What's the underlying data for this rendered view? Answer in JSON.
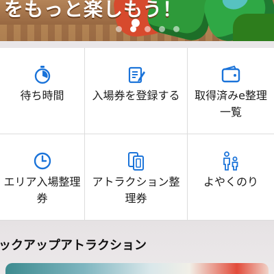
{
  "banner": {
    "headline": "をもっと楽しもう！",
    "slide_count": 5,
    "active_slide_index": 1
  },
  "menu": {
    "items": [
      {
        "label": "待ち時間",
        "icon": "stopwatch-icon"
      },
      {
        "label": "入場券を登録する",
        "icon": "ticket-edit-icon"
      },
      {
        "label": "取得済みe整理\n一覧",
        "icon": "wallet-icon"
      },
      {
        "label": "エリア入場整理\n券",
        "icon": "clock-icon"
      },
      {
        "label": "アトラクション整\n理券",
        "icon": "tickets-icon"
      },
      {
        "label": "よやくのり",
        "icon": "family-icon"
      }
    ]
  },
  "pickup": {
    "title": "ックアップアトラクション"
  },
  "colors": {
    "accent": "#1a73d9",
    "text": "#1a1a1a",
    "divider": "#dcdcdc"
  }
}
